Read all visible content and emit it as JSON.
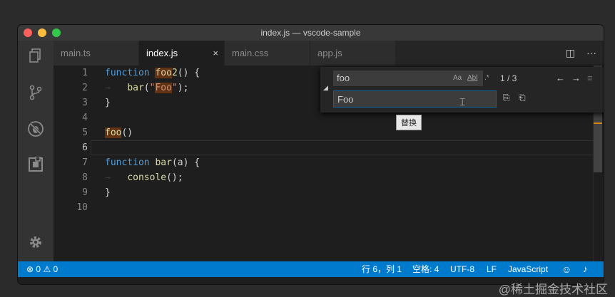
{
  "window": {
    "title": "index.js — vscode-sample"
  },
  "activity_bar": {
    "icons": [
      "files-icon",
      "source-control-icon",
      "debug-icon",
      "extensions-icon",
      "settings-gear-icon"
    ]
  },
  "tabs": [
    {
      "label": "main.ts",
      "active": false
    },
    {
      "label": "index.js",
      "active": true,
      "close": "×"
    },
    {
      "label": "main.css",
      "active": false
    },
    {
      "label": "app.js",
      "active": false
    }
  ],
  "tab_actions": {
    "split": "◫",
    "more": "···"
  },
  "editor": {
    "line_numbers": [
      "1",
      "2",
      "3",
      "4",
      "5",
      "6",
      "7",
      "8",
      "9",
      "10"
    ],
    "current_line": "6"
  },
  "find_widget": {
    "find_value": "foo",
    "replace_value": "Foo",
    "match_case": "Aa",
    "whole_word": "Abl",
    "regex": ".*",
    "match_count": "1 / 3",
    "prev": "←",
    "next": "→",
    "selection": "≡",
    "close": "✕",
    "replace_one": "⎘",
    "replace_all": "⎗",
    "tooltip": "替换"
  },
  "status_bar": {
    "errors": "0",
    "warnings": "0",
    "position": "行 6，列 1",
    "spaces": "空格: 4",
    "encoding": "UTF-8",
    "eol": "LF",
    "language": "JavaScript"
  },
  "watermark": "@稀土掘金技术社区",
  "colors": {
    "status_bar": "#007acc",
    "match_highlight": "#613214",
    "keyword": "#569cd6",
    "function": "#dcdcaa",
    "string": "#ce9178"
  }
}
